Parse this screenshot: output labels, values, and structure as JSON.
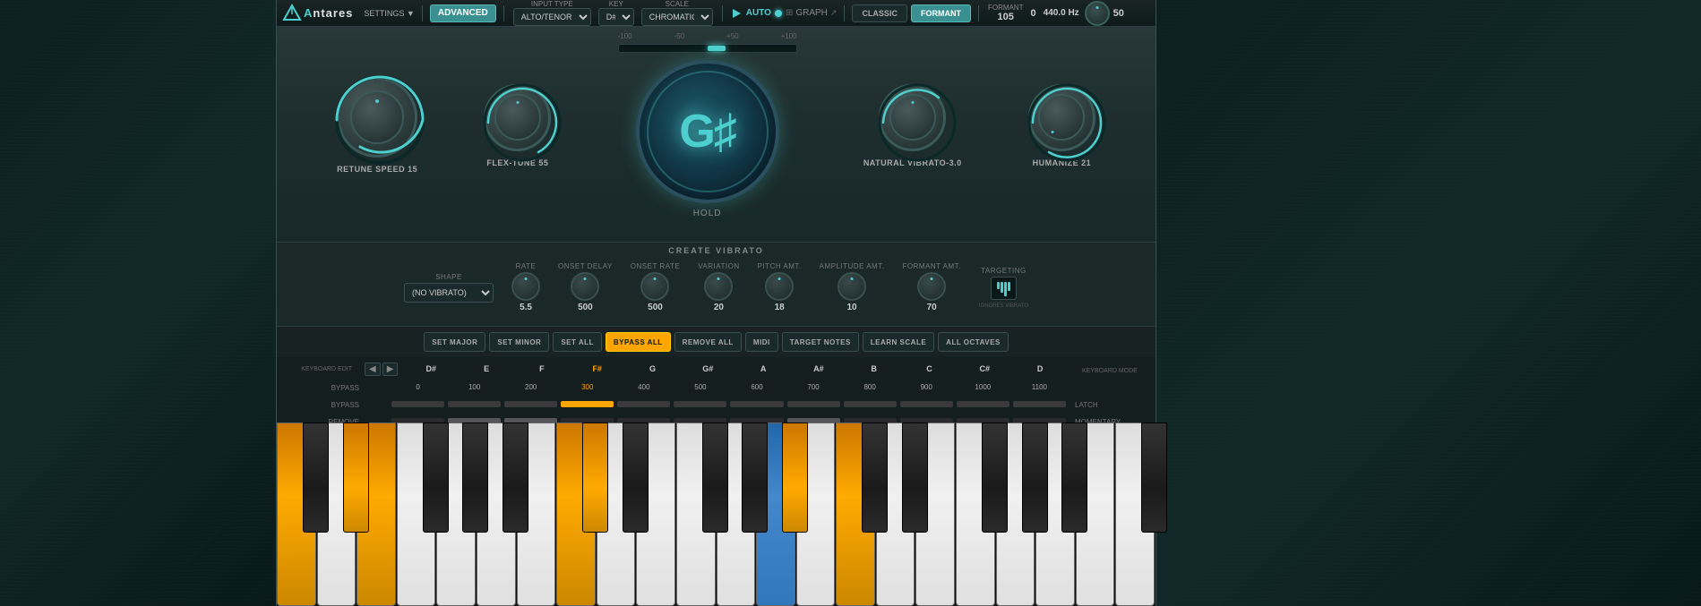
{
  "app": {
    "logo": "ntares",
    "logo_prefix": "A",
    "settings_label": "SETTINGS ▼"
  },
  "top_bar": {
    "advanced_label": "ADVANCED",
    "input_type_label": "INPUT TYPE",
    "input_type_value": "ALTO/TENOR",
    "key_label": "KEY",
    "key_value": "D#",
    "scale_label": "SCALE",
    "scale_value": "CHROMATIC",
    "auto_label": "AUTO",
    "graph_label": "GRAPH",
    "classic_label": "CLASSIC",
    "formant_label": "FORMANT",
    "formant_value": "105",
    "formant_field_label": "FORMANT",
    "pitch_value": "0",
    "hz_value": "440.0 Hz",
    "last_value": "50"
  },
  "knobs": {
    "retune_speed_label": "RETUNE SPEED",
    "retune_speed_value": "15",
    "flex_tune_label": "FLEX-TUNE",
    "flex_tune_value": "55",
    "pitch_note": "G♯",
    "hold_label": "HOLD",
    "pitch_range_low": "-100",
    "pitch_range_high": "+100",
    "pitch_low_marker": "-50",
    "pitch_high_marker": "+50",
    "natural_vibrato_label": "NATURAL VIBRATO",
    "natural_vibrato_value": "-3.0",
    "humanize_label": "HUMANIZE",
    "humanize_value": "21"
  },
  "vibrato": {
    "title": "CREATE VIBRATO",
    "shape_label": "SHAPE",
    "shape_value": "(NO VIBRATO)",
    "rate_label": "RATE",
    "rate_value": "5.5",
    "onset_delay_label": "ONSET DELAY",
    "onset_delay_value": "500",
    "onset_rate_label": "ONSET RATE",
    "onset_rate_value": "500",
    "variation_label": "VARIATION",
    "variation_value": "20",
    "pitch_amt_label": "PITCH AMT.",
    "pitch_amt_value": "18",
    "amplitude_amt_label": "AMPLITUDE AMT.",
    "amplitude_amt_value": "10",
    "formant_amt_label": "FORMANT AMT.",
    "formant_amt_value": "70"
  },
  "keyboard": {
    "set_major_label": "SET MAJOR",
    "set_minor_label": "SET MINOR",
    "set_all_label": "SET ALL",
    "bypass_all_label": "BYPASS ALL",
    "remove_all_label": "REMOVE ALL",
    "midi_label": "MIDI",
    "target_notes_label": "TARGET NOTES",
    "learn_scale_label": "LEARN SCALE",
    "all_octaves_label": "ALL OCTAVES",
    "targeting_label": "TARGETING",
    "ignores_vibrato_label": "IGNORES VIBRATO",
    "keyboard_edit_label": "KEYBOARD EDIT",
    "remove_label": "REMOVE",
    "bypass_label": "BYPASS",
    "keyboard_mode_label": "KEYBOARD MODE",
    "latch_label": "LATCH",
    "momentary_label": "MOMENTARY"
  },
  "note_keys": [
    {
      "name": "D#",
      "cents": "0",
      "bypass": false,
      "highlighted": false
    },
    {
      "name": "E",
      "cents": "100",
      "bypass": false,
      "highlighted": false
    },
    {
      "name": "F",
      "cents": "200",
      "bypass": false,
      "highlighted": false
    },
    {
      "name": "F#",
      "cents": "300",
      "bypass": true,
      "highlighted": true
    },
    {
      "name": "G",
      "cents": "400",
      "bypass": false,
      "highlighted": false
    },
    {
      "name": "G#",
      "cents": "500",
      "bypass": false,
      "highlighted": false
    },
    {
      "name": "A",
      "cents": "600",
      "bypass": false,
      "highlighted": false
    },
    {
      "name": "A#",
      "cents": "700",
      "bypass": false,
      "highlighted": false
    },
    {
      "name": "B",
      "cents": "800",
      "bypass": false,
      "highlighted": false
    },
    {
      "name": "C",
      "cents": "900",
      "bypass": false,
      "highlighted": false
    },
    {
      "name": "C#",
      "cents": "1000",
      "bypass": false,
      "highlighted": false
    },
    {
      "name": "D",
      "cents": "1100",
      "bypass": false,
      "highlighted": false
    }
  ],
  "colors": {
    "accent": "#4ecfcf",
    "orange": "#ffa500",
    "blue_key": "#4488cc",
    "dark_bg": "#0a1818",
    "panel_bg": "#1e2e2e",
    "active_btn": "#3a9090"
  }
}
